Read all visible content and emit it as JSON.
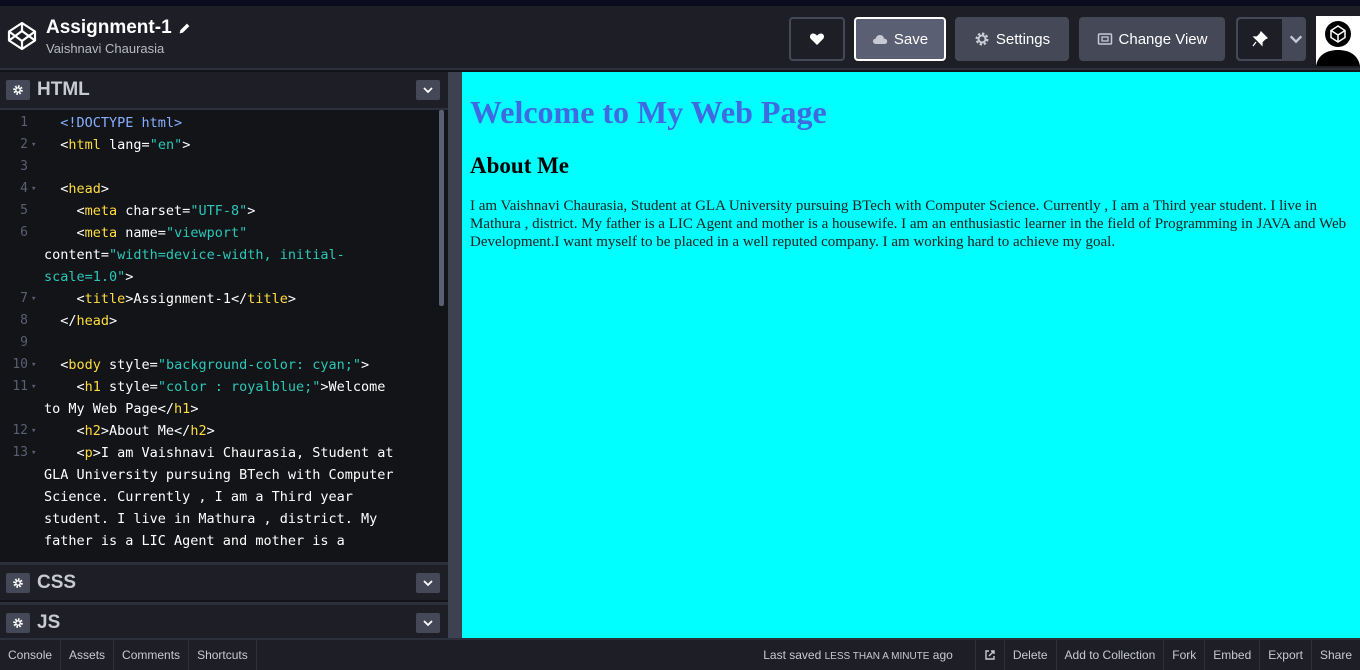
{
  "header": {
    "title": "Assignment-1",
    "author": "Vaishnavi Chaurasia",
    "save_label": "Save",
    "settings_label": "Settings",
    "changeview_label": "Change View"
  },
  "panels": {
    "html_label": "HTML",
    "css_label": "CSS",
    "js_label": "JS"
  },
  "code": [
    {
      "n": "1",
      "fold": "",
      "html": "<span class='dt'>&lt;!DOCTYPE html&gt;</span>",
      "indent": "  "
    },
    {
      "n": "2",
      "fold": "▾",
      "html": "&lt;<span class='t'>html</span> lang=<span class='s'>\"en\"</span>&gt;",
      "indent": "  "
    },
    {
      "n": "3",
      "fold": "",
      "html": "",
      "indent": ""
    },
    {
      "n": "4",
      "fold": "▾",
      "html": "&lt;<span class='t'>head</span>&gt;",
      "indent": "  "
    },
    {
      "n": "5",
      "fold": "",
      "html": "&lt;<span class='t'>meta</span> charset=<span class='s'>\"UTF-8\"</span>&gt;",
      "indent": "    "
    },
    {
      "n": "6",
      "fold": "",
      "html": "&lt;<span class='t'>meta</span> name=<span class='s'>\"viewport\"</span>",
      "indent": "    "
    },
    {
      "n": "",
      "fold": "",
      "html": "content=<span class='s'>\"width=device-width, initial-</span>",
      "indent": ""
    },
    {
      "n": "",
      "fold": "",
      "html": "<span class='s'>scale=1.0\"</span>&gt;",
      "indent": ""
    },
    {
      "n": "7",
      "fold": "▾",
      "html": "&lt;<span class='t'>title</span>&gt;Assignment-1&lt;/<span class='t'>title</span>&gt;",
      "indent": "    "
    },
    {
      "n": "8",
      "fold": "",
      "html": "&lt;/<span class='t'>head</span>&gt;",
      "indent": "  "
    },
    {
      "n": "9",
      "fold": "",
      "html": "",
      "indent": ""
    },
    {
      "n": "10",
      "fold": "▾",
      "html": "&lt;<span class='t'>body</span> style=<span class='s'>\"background-color: cyan;\"</span>&gt;",
      "indent": "  "
    },
    {
      "n": "11",
      "fold": "▾",
      "html": "&lt;<span class='t'>h1</span> style=<span class='s'>\"color : royalblue;\"</span>&gt;Welcome",
      "indent": "    "
    },
    {
      "n": "",
      "fold": "",
      "html": "to My Web Page&lt;/<span class='t'>h1</span>&gt;",
      "indent": ""
    },
    {
      "n": "12",
      "fold": "▾",
      "html": "&lt;<span class='t'>h2</span>&gt;About Me&lt;/<span class='t'>h2</span>&gt;",
      "indent": "    "
    },
    {
      "n": "13",
      "fold": "▾",
      "html": "&lt;<span class='t'>p</span>&gt;I am Vaishnavi Chaurasia, Student at",
      "indent": "    "
    },
    {
      "n": "",
      "fold": "",
      "html": "GLA University pursuing BTech with Computer",
      "indent": ""
    },
    {
      "n": "",
      "fold": "",
      "html": "Science. Currently , I am a Third year",
      "indent": ""
    },
    {
      "n": "",
      "fold": "",
      "html": "student. I live in Mathura , district. My",
      "indent": ""
    },
    {
      "n": "",
      "fold": "",
      "html": "father is a LIC Agent and mother is a",
      "indent": ""
    }
  ],
  "preview": {
    "h1": "Welcome to My Web Page",
    "h2": "About Me",
    "p": "I am Vaishnavi Chaurasia, Student at GLA University pursuing BTech with Computer Science. Currently , I am a Third year student. I live in Mathura , district. My father is a LIC Agent and mother is a housewife. I am an enthusiastic learner in the field of Programming in JAVA and Web Development.I want myself to be placed in a well reputed company. I am working hard to achieve my goal."
  },
  "footer": {
    "left": [
      "Console",
      "Assets",
      "Comments",
      "Shortcuts"
    ],
    "last_saved_prefix": "Last saved",
    "last_saved_time": "LESS THAN A MINUTE",
    "last_saved_suffix": "ago",
    "right": [
      "Delete",
      "Add to Collection",
      "Fork",
      "Embed",
      "Export",
      "Share"
    ]
  }
}
